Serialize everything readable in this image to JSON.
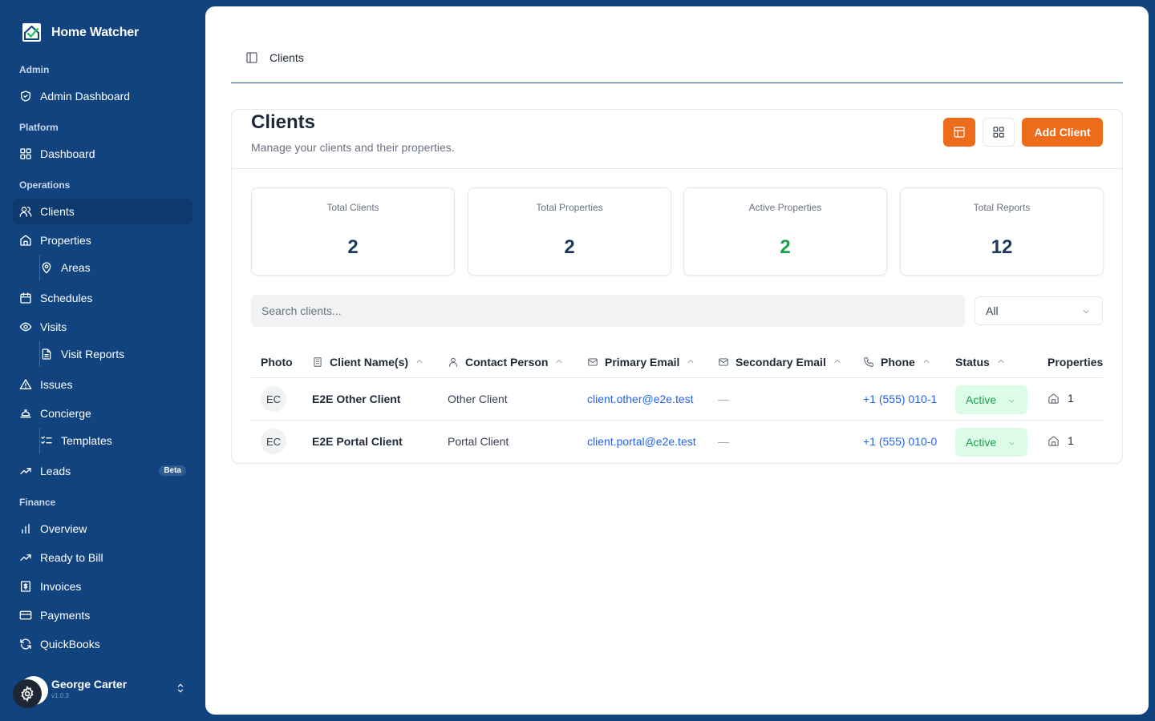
{
  "app": {
    "name": "Home Watcher",
    "version": "v1.0.3"
  },
  "sidebar": {
    "sections": {
      "admin": "Admin",
      "platform": "Platform",
      "operations": "Operations",
      "finance": "Finance"
    },
    "items": {
      "admin_dashboard": "Admin Dashboard",
      "dashboard": "Dashboard",
      "clients": "Clients",
      "properties": "Properties",
      "areas": "Areas",
      "schedules": "Schedules",
      "visits": "Visits",
      "visit_reports": "Visit Reports",
      "issues": "Issues",
      "concierge": "Concierge",
      "templates": "Templates",
      "leads": "Leads",
      "leads_badge": "Beta",
      "overview": "Overview",
      "ready_to_bill": "Ready to Bill",
      "invoices": "Invoices",
      "payments": "Payments",
      "quickbooks": "QuickBooks"
    },
    "active_item": "clients",
    "user": {
      "name": "George Carter"
    }
  },
  "breadcrumb": {
    "current": "Clients"
  },
  "page": {
    "title": "Clients",
    "subtitle": "Manage your clients and their properties.",
    "add_button": "Add Client"
  },
  "stats": [
    {
      "label": "Total Clients",
      "value": "2"
    },
    {
      "label": "Total Properties",
      "value": "2"
    },
    {
      "label": "Active Properties",
      "value": "2"
    },
    {
      "label": "Total Reports",
      "value": "12"
    }
  ],
  "search": {
    "placeholder": "Search clients...",
    "value": ""
  },
  "filter": {
    "selected": "All"
  },
  "table": {
    "headers": {
      "photo": "Photo",
      "client_names": "Client Name(s)",
      "contact_person": "Contact Person",
      "primary_email": "Primary Email",
      "secondary_email": "Secondary Email",
      "phone": "Phone",
      "status": "Status",
      "properties": "Properties"
    },
    "rows": [
      {
        "initials": "EC",
        "name": "E2E Other Client",
        "contact": "Other Client",
        "primary_email": "client.other@e2e.test",
        "secondary_email": "—",
        "phone": "+1 (555) 010-1",
        "status": "Active",
        "properties": "1"
      },
      {
        "initials": "EC",
        "name": "E2E Portal Client",
        "contact": "Portal Client",
        "primary_email": "client.portal@e2e.test",
        "secondary_email": "—",
        "phone": "+1 (555) 010-0",
        "status": "Active",
        "properties": "1"
      }
    ]
  },
  "colors": {
    "sidebar_bg": "#11447f",
    "accent": "#ed6c1b",
    "active_green": "#16a34a",
    "link_blue": "#2563eb"
  }
}
